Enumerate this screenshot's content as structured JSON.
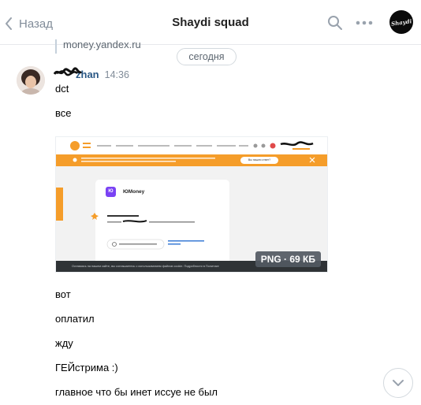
{
  "header": {
    "back_label": "Назад",
    "title": "Shaydi squad",
    "search_icon": "search-icon",
    "more_icon": "more-icon",
    "avatar_text": "Shaydi"
  },
  "conversation": {
    "link_snippet": "money.yandex.ru",
    "date_divider": "сегодня",
    "author_name": "zhan",
    "time": "14:36",
    "messages_before_image": [
      "dct",
      "все"
    ],
    "attachment": {
      "card_title": "ЮMoney",
      "prompt_button": "Вы нашли ответ?",
      "footer_note": "Оставаясь на нашем сайте, вы соглашаетесь с использованием файлов cookie. Подробности в Политике",
      "badge": "PNG · 69 КБ"
    },
    "messages_after_image": [
      "вот",
      "оплатил",
      "жду",
      "ГЕЙстрима :)",
      "главное что бы инет иссуе не был"
    ]
  },
  "colors": {
    "accent_blue": "#2a5885",
    "muted_gray": "#818c99",
    "divider": "#e7e8ec",
    "orange": "#f59d2a"
  }
}
